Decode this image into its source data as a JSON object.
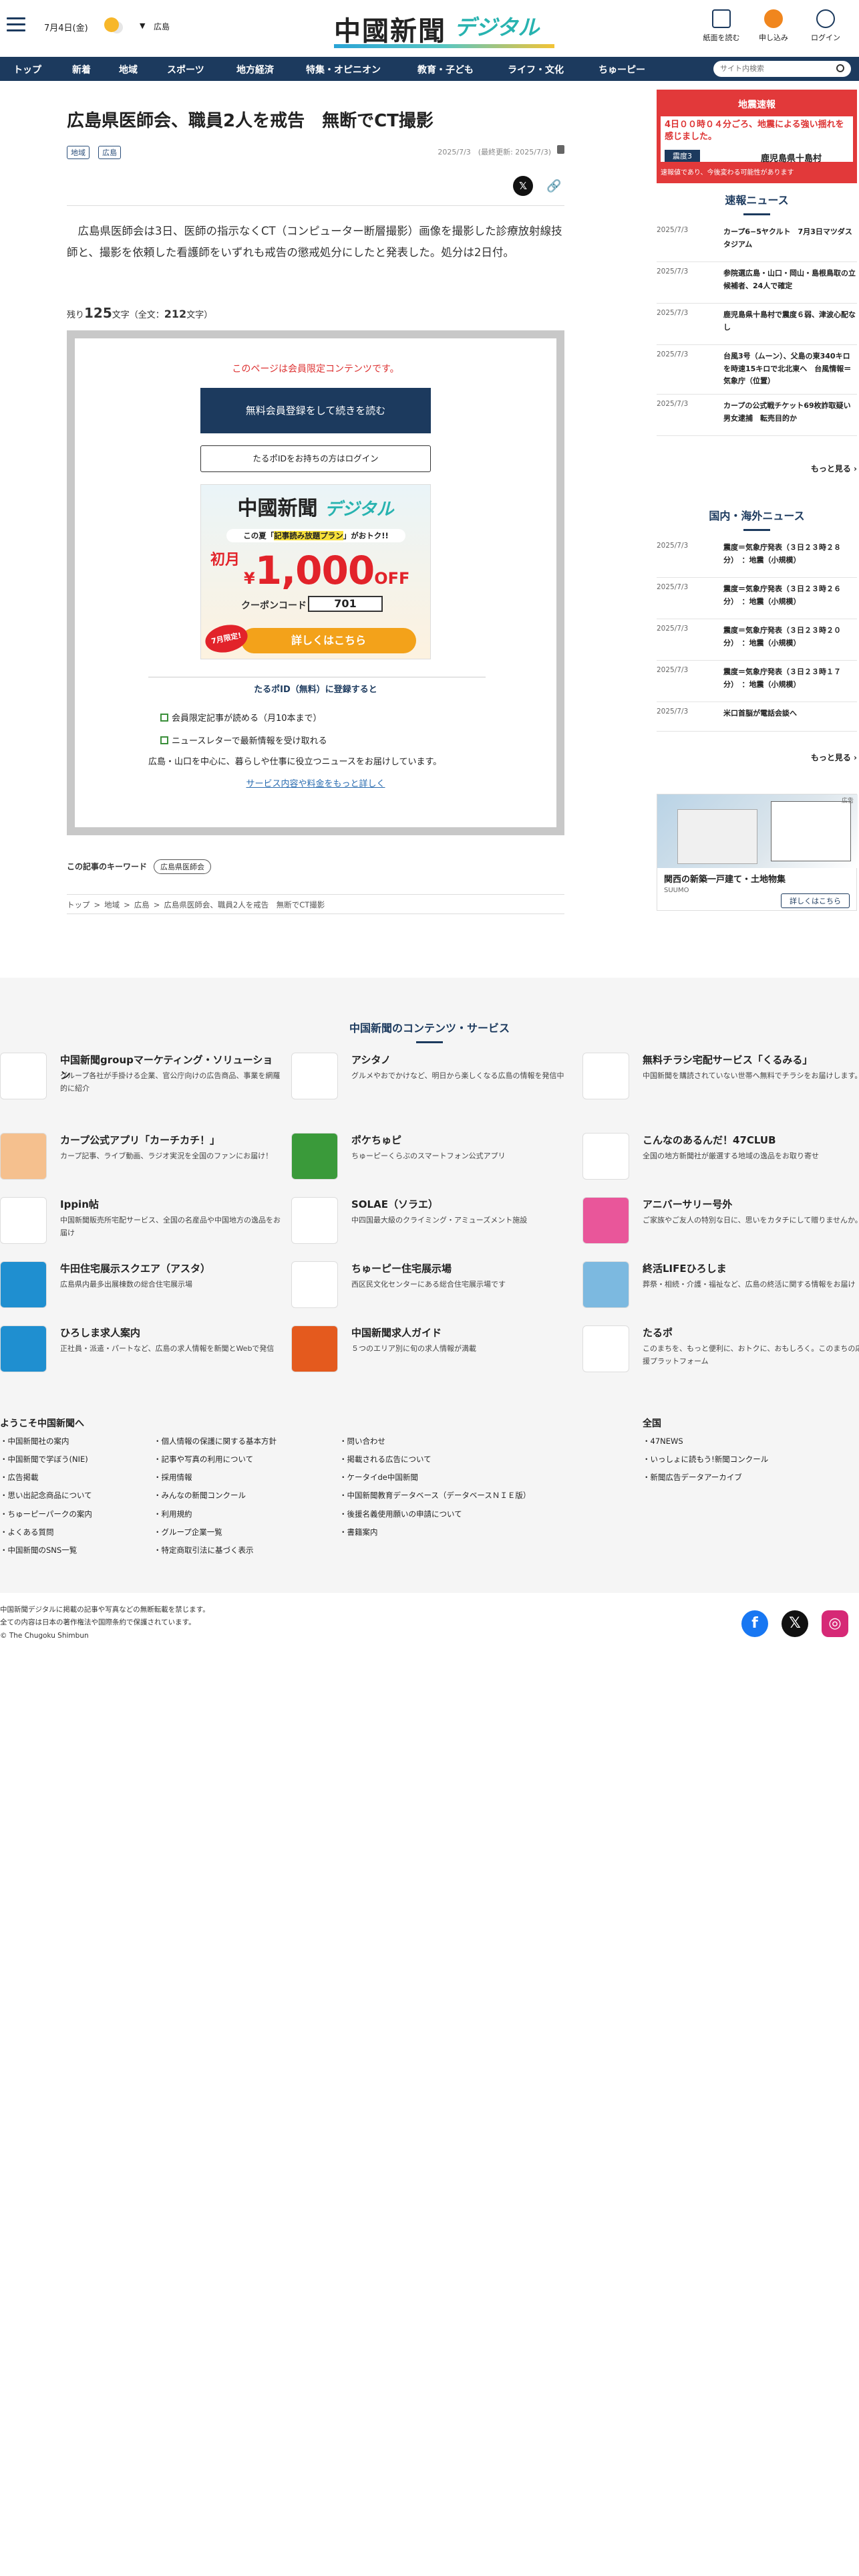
{
  "header": {
    "date": "7月4日(金)",
    "region": "広島",
    "logo_main": "中國新聞",
    "logo_sub": "デジタル",
    "icons": [
      {
        "label": "紙面を読む",
        "icon": "newspaper-icon"
      },
      {
        "label": "申し込み",
        "icon": "signup-icon"
      },
      {
        "label": "ログイン",
        "icon": "login-icon"
      }
    ]
  },
  "nav": {
    "items": [
      "トップ",
      "新着",
      "地域",
      "スポーツ",
      "地方経済",
      "特集・オピニオン",
      "教育・子ども",
      "ライフ・文化",
      "ちゅーピー"
    ],
    "search_placeholder": "サイト内検索"
  },
  "article": {
    "title": "広島県医師会、職員2人を戒告　無断でCT撮影",
    "tags": [
      "地域",
      "広島"
    ],
    "dates": "2025/7/3　(最終更新: 2025/7/3)",
    "lead": "　広島県医師会は3日、医師の指示なくCT（コンピューター断層撮影）画像を撮影した診療放射線技師と、撮影を依頼した看護師をいずれも戒告の懲戒処分にしたと発表した。処分は2日付。",
    "remaining_prefix": "残り",
    "remaining_count": "125",
    "remaining_suffix": "文字（全文：",
    "total_count": "212",
    "total_suffix": "文字）"
  },
  "paywall": {
    "notice": "このページは会員限定コンテンツです。",
    "register_button": "無料会員登録をして続きを読む",
    "login_button": "たるポIDをお持ちの方はログイン",
    "promo": {
      "logo_main": "中國新聞",
      "logo_sub": "デジタル",
      "plan_text_a": "この夏「",
      "plan_text_b": "記事読み放題プラン",
      "plan_text_c": "」がおトク!!",
      "price_prefix": "初月",
      "price_yen": "¥",
      "price": "1,000",
      "price_suffix": "OFF",
      "coupon_label": "クーポンコード",
      "coupon_code": "701",
      "limited": "7月限定!",
      "detail_button": "詳しくはこちら"
    },
    "benefits_heading": "たるポID（無料）に登録すると",
    "benefits": [
      "会員限定記事が読める（月10本まで）",
      "ニュースレターで最新情報を受け取れる"
    ],
    "benefits_note": "広島・山口を中心に、暮らしや仕事に役立つニュースをお届けしています。",
    "more_link": "サービス内容や料金をもっと詳しく"
  },
  "keywords": {
    "label": "この記事のキーワード",
    "items": [
      "広島県医師会"
    ]
  },
  "breadcrumb": [
    "トップ",
    ">",
    "地域",
    ">",
    "広島",
    ">",
    "広島県医師会、職員2人を戒告　無断でCT撮影"
  ],
  "sidebar": {
    "quake": {
      "title": "地震速報",
      "headline": "4日００時０４分ごろ、地震による強い揺れを感じました。",
      "intensity": "震度3",
      "location": "鹿児島県十島村",
      "note": "速報値であり、今後変わる可能性があります"
    },
    "breaking": {
      "heading": "速報ニュース",
      "items": [
        {
          "date": "2025/7/3",
          "title": "カープ6−5ヤクルト　7月3日マツダスタジアム"
        },
        {
          "date": "2025/7/3",
          "title": "参院選広島・山口・岡山・島根鳥取の立候補者、24人で確定"
        },
        {
          "date": "2025/7/3",
          "title": "鹿児島県十島村で震度６弱、津波心配なし"
        },
        {
          "date": "2025/7/3",
          "title": "台風3号（ムーン）、父島の東340キロを時速15キロで北北東へ　台風情報＝気象庁（位置）"
        },
        {
          "date": "2025/7/3",
          "title": "カープの公式戦チケット69枚詐取疑い　男女逮捕　転売目的か"
        }
      ],
      "more": "もっと見る"
    },
    "world": {
      "heading": "国内・海外ニュース",
      "items": [
        {
          "date": "2025/7/3",
          "title": "震度＝気象庁発表（３日２３時２８分）　：地震（小規模）"
        },
        {
          "date": "2025/7/3",
          "title": "震度＝気象庁発表（３日２３時２６分）　：地震（小規模）"
        },
        {
          "date": "2025/7/3",
          "title": "震度＝気象庁発表（３日２３時２０分）　：地震（小規模）"
        },
        {
          "date": "2025/7/3",
          "title": "震度＝気象庁発表（３日２３時１７分）　：地震（小規模）"
        },
        {
          "date": "2025/7/3",
          "title": "米口首脳が電話会談へ"
        }
      ],
      "more": "もっと見る"
    },
    "ad": {
      "label": "広告",
      "title": "関西の新築一戸建て・土地物集",
      "sponsor": "SUUMO",
      "button": "詳しくはこちら"
    }
  },
  "services": {
    "heading": "中国新聞のコンテンツ・サービス",
    "items": [
      {
        "title": "中国新聞groupマーケティング・ソリューション",
        "desc": "グループ各社が手掛ける企業、官公庁向けの広告商品、事業を網羅的に紹介",
        "logo_color": "#ffffff"
      },
      {
        "title": "アシタノ",
        "desc": "グルメやおでかけなど、明日から楽しくなる広島の情報を発信中",
        "logo_color": "#ffffff"
      },
      {
        "title": "無料チラシ宅配サービス「くるみる」",
        "desc": "中国新聞を購読されていない世帯へ無料でチラシをお届けします。",
        "logo_color": "#ffffff"
      },
      {
        "title": "カープ公式アプリ「カーチカチ！」",
        "desc": "カープ記事、ライブ動画、ラジオ実況を全国のファンにお届け！",
        "logo_color": "#f5c08e"
      },
      {
        "title": "ポケちゅピ",
        "desc": "ちゅーピーくらぶのスマートフォン公式アプリ",
        "logo_color": "#3a9a3a"
      },
      {
        "title": "こんなのあるんだ！47CLUB",
        "desc": "全国の地方新聞社が厳選する地域の逸品をお取り寄せ",
        "logo_color": "#ffffff"
      },
      {
        "title": "Ippin帖",
        "desc": "中国新聞販売所宅配サービス、全国の名産品や中国地方の逸品をお届け",
        "logo_color": "#ffffff"
      },
      {
        "title": "SOLAE（ソラエ）",
        "desc": "中四国最大級のクライミング・アミューズメント施設",
        "logo_color": "#ffffff"
      },
      {
        "title": "アニバーサリー号外",
        "desc": "ご家族やご友人の特別な日に、思いをカタチにして贈りませんか。",
        "logo_color": "#e9569a"
      },
      {
        "title": "牛田住宅展示スクエア（アスタ）",
        "desc": "広島県内最多出展棟数の総合住宅展示場",
        "logo_color": "#1f8fd0"
      },
      {
        "title": "ちゅーピー住宅展示場",
        "desc": "西区民文化センターにある総合住宅展示場です",
        "logo_color": "#ffffff"
      },
      {
        "title": "終活LIFEひろしま",
        "desc": "葬祭・相続・介護・福祉など、広島の終活に関する情報をお届け",
        "logo_color": "#7cb9e0"
      },
      {
        "title": "ひろしま求人案内",
        "desc": "正社員・派遣・パートなど、広島の求人情報を新聞とWebで発信",
        "logo_color": "#1f8fd0"
      },
      {
        "title": "中国新聞求人ガイド",
        "desc": "５つのエリア別に旬の求人情報が満載",
        "logo_color": "#e45a1e"
      },
      {
        "title": "たるポ",
        "desc": "このまちを、もっと便利に、おトクに、おもしろく。このまちの応援プラットフォーム",
        "logo_color": "#ffffff"
      }
    ]
  },
  "footer": {
    "welcome": "ようこそ中国新聞へ",
    "national": "全国",
    "col1": [
      "中国新聞社の案内",
      "中国新聞で学ぼう(NIE)",
      "広告掲載",
      "思い出記念商品について",
      "ちゅーピーパークの案内",
      "よくある質問",
      "中国新聞のSNS一覧"
    ],
    "col2": [
      "個人情報の保護に関する基本方針",
      "記事や写真の利用について",
      "採用情報",
      "みんなの新聞コンクール",
      "利用規約",
      "グループ企業一覧",
      "特定商取引法に基づく表示"
    ],
    "col3": [
      "問い合わせ",
      "掲載される広告について",
      "ケータイde中国新聞",
      "中国新聞教育データベース（データベースＮＩＥ版）",
      "後援名義使用願いの申請について",
      "書籍案内"
    ],
    "col4": [
      "47NEWS",
      "いっしょに読もう!新聞コンクール",
      "新聞広告データアーカイブ"
    ],
    "copyright": [
      "中国新聞デジタルに掲載の記事や写真などの無断転載を禁じます。",
      "全ての内容は日本の著作権法や国際条約で保護されています。",
      "© The Chugoku Shimbun"
    ],
    "sns": [
      {
        "name": "facebook-icon",
        "color": "#1877f2"
      },
      {
        "name": "x-icon",
        "color": "#111111"
      },
      {
        "name": "instagram-icon",
        "color": "#d62976"
      }
    ]
  }
}
